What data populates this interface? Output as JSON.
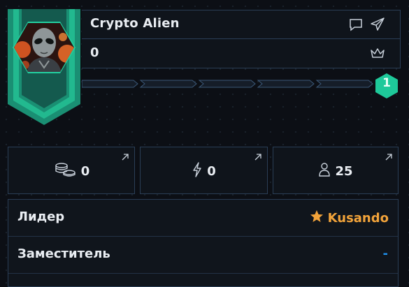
{
  "profile": {
    "name": "Crypto Alien",
    "score": "0",
    "level": "1"
  },
  "progress": {
    "segments_total": 5,
    "segments_filled": 0
  },
  "stats": {
    "coins": "0",
    "energy": "0",
    "members": "25"
  },
  "info": {
    "leader_label": "Лидер",
    "leader_value": "Kusando",
    "deputy_label": "Заместитель",
    "deputy_value": "-"
  },
  "icons": {
    "chat": "chat-icon",
    "send": "send-icon",
    "crown": "crown-icon",
    "coins": "coins-icon",
    "energy": "lightning-icon",
    "members": "user-icon",
    "open": "arrow-up-right-icon",
    "star": "star-icon"
  },
  "colors": {
    "accent": "#1ec99a",
    "leader": "#f2a33a",
    "deputy": "#1e8ee8",
    "border": "#2a3e56"
  }
}
